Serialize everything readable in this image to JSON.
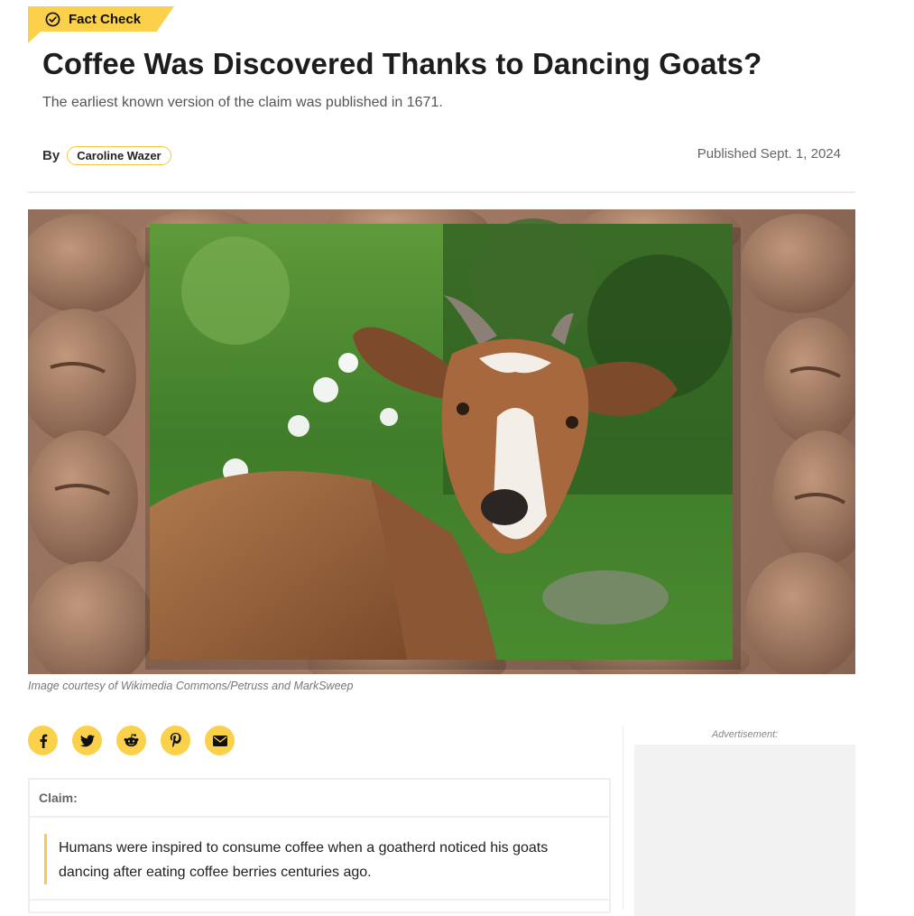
{
  "badge": {
    "label": "Fact Check",
    "icon": "check-circle-icon",
    "color": "#fbd04a"
  },
  "article": {
    "title": "Coffee Was Discovered Thanks to Dancing Goats?",
    "subtitle": "The earliest known version of the claim was published in 1671.",
    "by_label": "By",
    "author": "Caroline Wazer",
    "published": "Published Sept. 1, 2024"
  },
  "hero": {
    "caption": "Image courtesy of Wikimedia Commons/Petruss and MarkSweep"
  },
  "share": {
    "buttons": [
      {
        "icon": "facebook-icon"
      },
      {
        "icon": "twitter-icon"
      },
      {
        "icon": "reddit-icon"
      },
      {
        "icon": "pinterest-icon"
      },
      {
        "icon": "email-icon"
      }
    ]
  },
  "claim": {
    "label": "Claim:",
    "text_line1": "Humans were inspired to consume coffee when a goatherd noticed his goats",
    "text_line2": "dancing after eating coffee berries centuries ago."
  },
  "sidebar": {
    "ad_label": "Advertisement:"
  },
  "colors": {
    "accent": "#fbd04a",
    "text": "#1f1f1f",
    "muted": "#666666"
  }
}
